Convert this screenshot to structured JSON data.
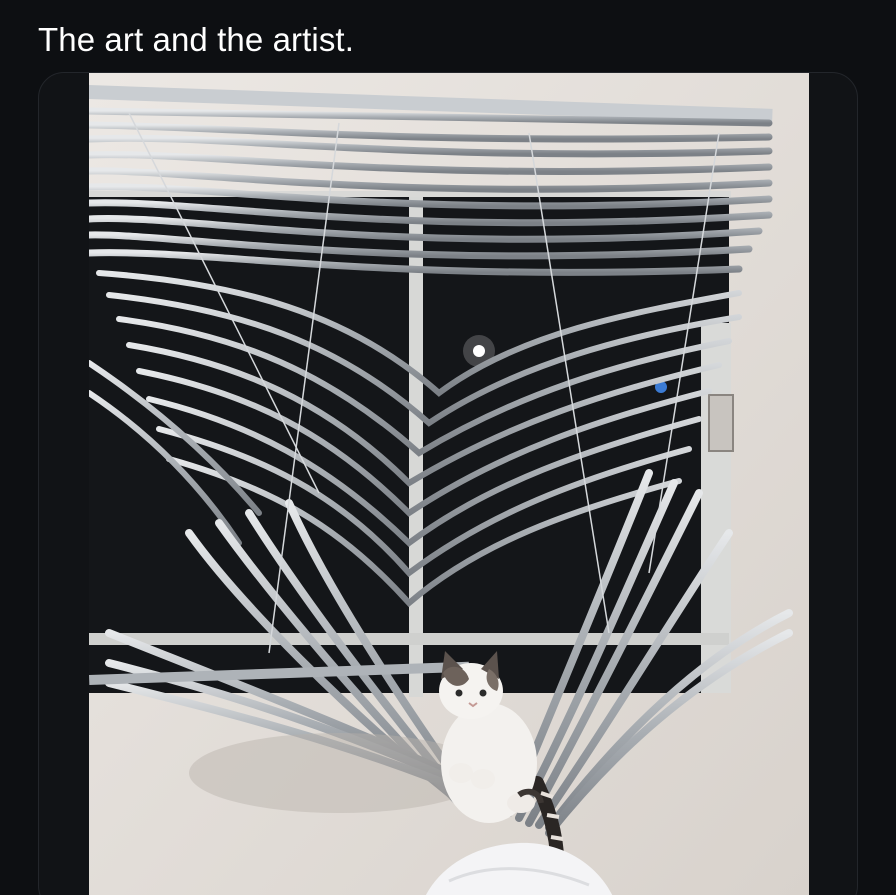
{
  "post": {
    "text": "The art and the artist."
  },
  "media": {
    "alt": "photo-cat-wrecked-blinds",
    "colors": {
      "background": "#0d0f12",
      "wall": "#e9e4df",
      "blinds": "#b9bdc1",
      "window_dark": "#141619",
      "frame": "#d9d9d7"
    }
  }
}
